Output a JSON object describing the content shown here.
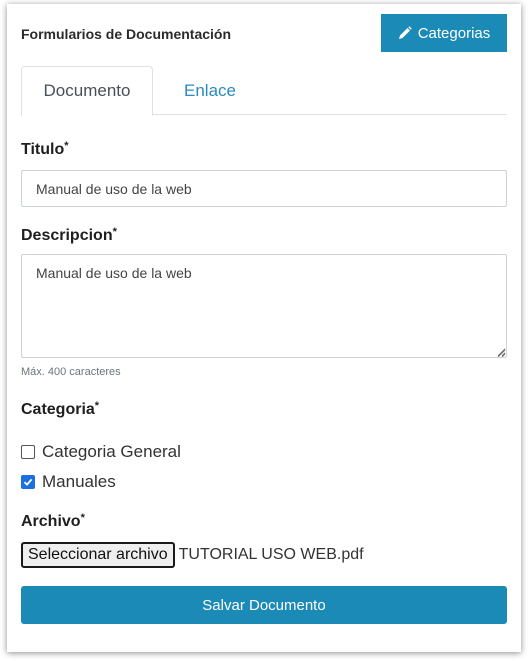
{
  "header": {
    "title": "Formularios de Documentación",
    "categories_label": "Categorias"
  },
  "tabs": [
    {
      "label": "Documento",
      "active": true
    },
    {
      "label": "Enlace",
      "active": false
    }
  ],
  "form": {
    "title_label": "Titulo",
    "title_value": "Manual de uso de la web",
    "required_mark": "*",
    "description_label": "Descripcion",
    "description_value": "Manual de uso de la web",
    "description_helper": "Máx. 400 caracteres",
    "category_label": "Categoria",
    "categories": [
      {
        "label": "Categoria General",
        "checked": false
      },
      {
        "label": "Manuales",
        "checked": true
      }
    ],
    "file_label": "Archivo",
    "file_button_label": "Seleccionar archivo",
    "file_name": "TUTORIAL USO WEB.pdf",
    "submit_label": "Salvar Documento"
  },
  "colors": {
    "primary": "#1b8ab6",
    "tab_link": "#2b8bc0",
    "checkbox_checked": "#1b6fe0"
  }
}
